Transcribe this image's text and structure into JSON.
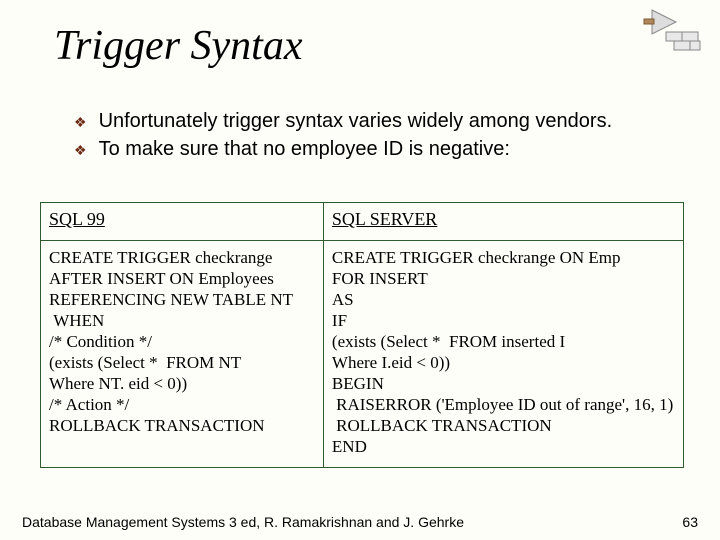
{
  "title": "Trigger Syntax",
  "bullets": [
    "Unfortunately trigger syntax varies widely among vendors.",
    "To make sure that no employee ID is negative:"
  ],
  "columns": {
    "left": {
      "header": "SQL 99",
      "code": "CREATE TRIGGER checkrange\nAFTER INSERT ON Employees\nREFERENCING NEW TABLE NT\n WHEN\n/* Condition */\n(exists (Select *  FROM NT\nWhere NT. eid < 0))\n/* Action */\nROLLBACK TRANSACTION"
    },
    "right": {
      "header": "SQL SERVER",
      "code": "CREATE TRIGGER checkrange ON Emp\nFOR INSERT\nAS\nIF\n(exists (Select *  FROM inserted I\nWhere I.eid < 0))\nBEGIN\n RAISERROR ('Employee ID out of range', 16, 1)\n ROLLBACK TRANSACTION\nEND"
    }
  },
  "footer": {
    "text": "Database Management Systems 3 ed,  R. Ramakrishnan and J. Gehrke",
    "page": "63"
  }
}
